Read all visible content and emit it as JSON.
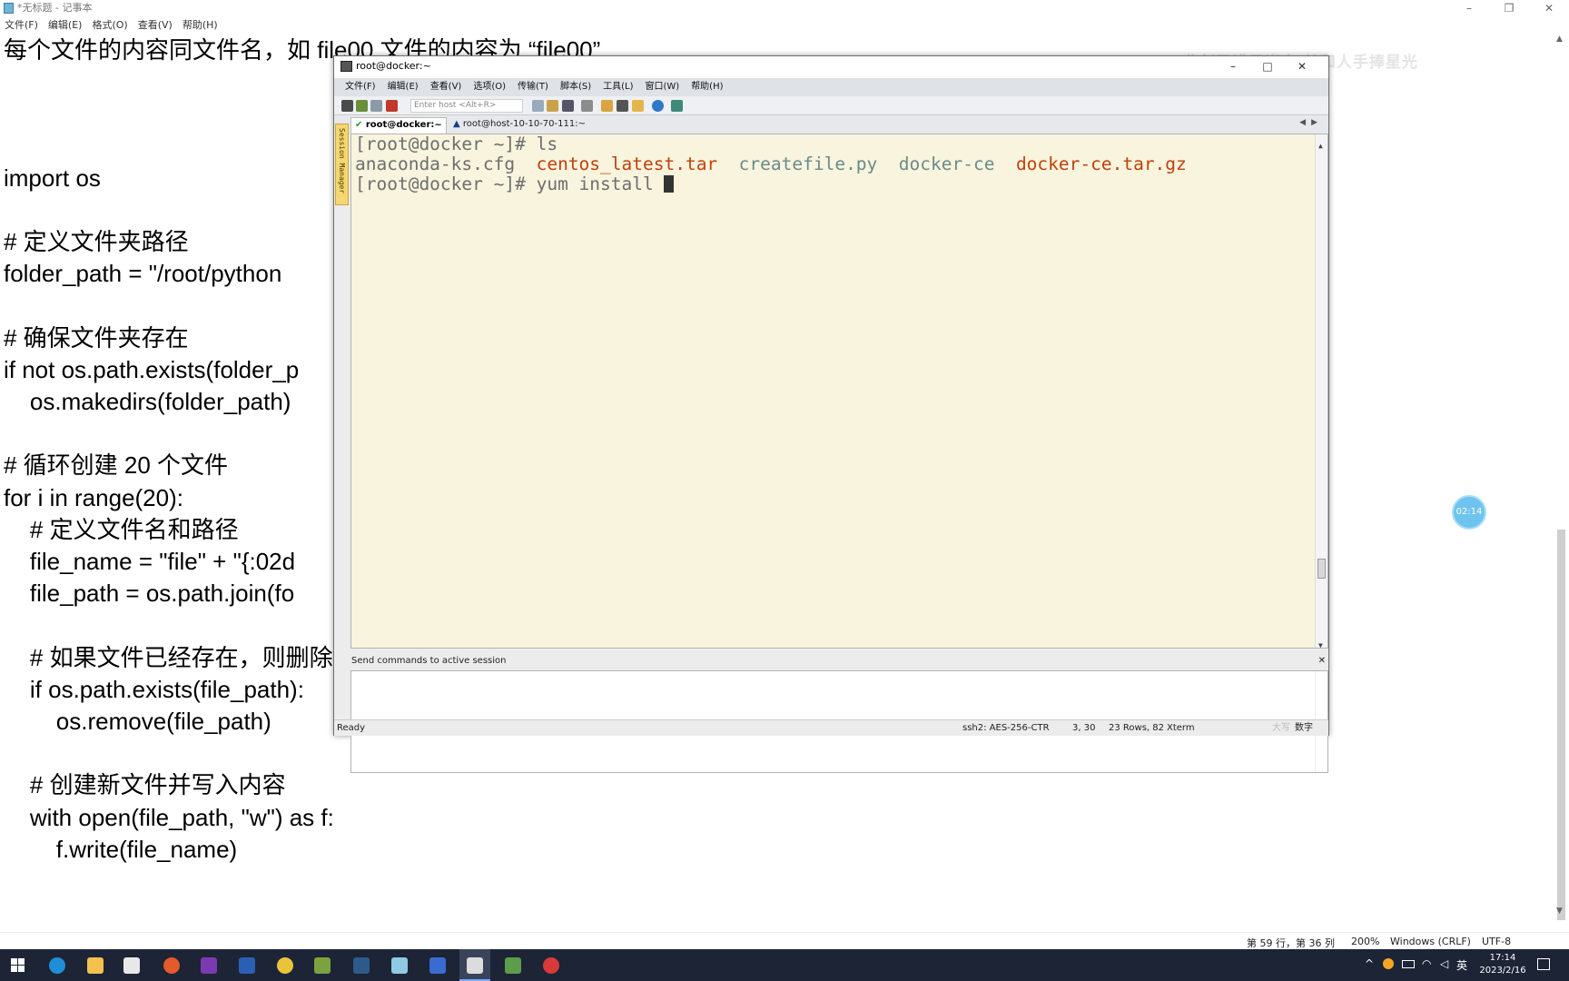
{
  "notepad": {
    "title": "*无标题 - 记事本",
    "menu": [
      "文件(F)",
      "编辑(E)",
      "格式(O)",
      "查看(V)",
      "帮助(H)"
    ],
    "lines": [
      "每个文件的内容同文件名，如 file00 文件的内容为 “file00”",
      "",
      "",
      "",
      "import os",
      "",
      "# 定义文件夹路径",
      "folder_path = \"/root/python",
      "",
      "# 确保文件夹存在",
      "if not os.path.exists(folder_p",
      "    os.makedirs(folder_path)",
      "",
      "# 循环创建 20 个文件",
      "for i in range(20):",
      "    # 定义文件名和路径",
      "    file_name = \"file\" + \"{:02d",
      "    file_path = os.path.join(fo",
      "",
      "    # 如果文件已经存在，则删除",
      "    if os.path.exists(file_path):",
      "        os.remove(file_path)",
      "",
      "    # 创建新文件并写入内容",
      "    with open(file_path, \"w\") as f:",
      "        f.write(file_name)"
    ],
    "status": {
      "position": "第 59 行，第 36 列",
      "zoom": "200%",
      "line_ending": "Windows (CRLF)",
      "encoding": "UTF-8"
    }
  },
  "overlay": {
    "watermark": "此刻已错月当空 梦和人手捧星光",
    "timer": "02:14"
  },
  "xshell": {
    "title": "root@docker:~",
    "menu": [
      "文件(F)",
      "编辑(E)",
      "查看(V)",
      "选项(O)",
      "传输(T)",
      "脚本(S)",
      "工具(L)",
      "窗口(W)",
      "帮助(H)"
    ],
    "host_placeholder": "Enter host <Alt+R>",
    "tabs": [
      {
        "label": "root@docker:~",
        "active": true
      },
      {
        "label": "root@host-10-10-70-111:~",
        "active": false
      }
    ],
    "session_manager": "Session Manager",
    "terminal": {
      "line1_prompt": "[root@docker ~]# ",
      "line1_cmd": "ls",
      "files": [
        "anaconda-ks.cfg",
        "centos_latest.tar",
        "createfile.py",
        "docker-ce",
        "docker-ce.tar.gz"
      ],
      "line3_prompt": "[root@docker ~]# ",
      "line3_cmd": "yum install "
    },
    "send_label": "Send commands to active session",
    "status": {
      "ready": "Ready",
      "ssh": "ssh2: AES-256-CTR",
      "cursor": "3, 30",
      "size": "23 Rows, 82",
      "term": "Xterm",
      "caps": "大写",
      "num": "数字"
    }
  },
  "taskbar": {
    "ime": "英",
    "time": "17:14",
    "date": "2023/2/16"
  }
}
